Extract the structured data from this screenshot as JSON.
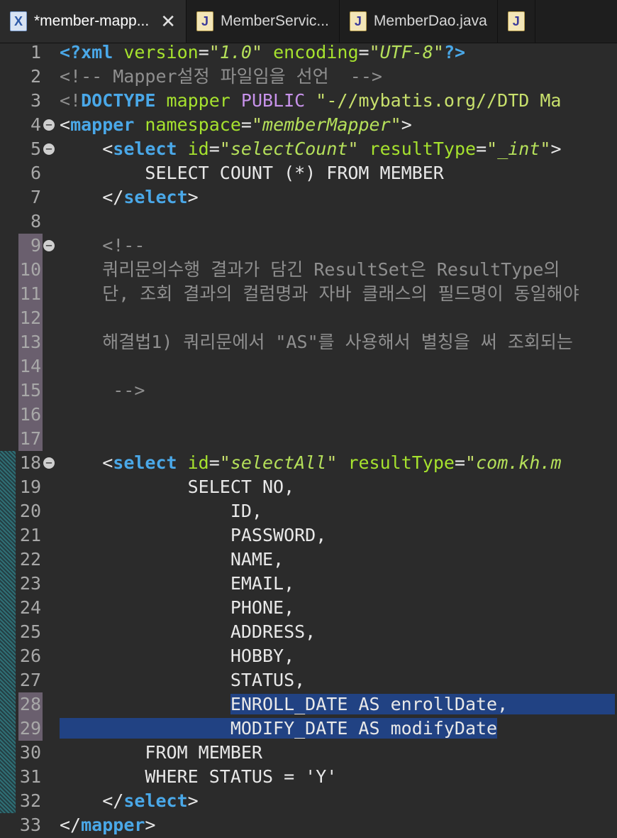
{
  "tabs": [
    {
      "label": "*member-mapp...",
      "icon": "xml-file-icon",
      "active": true
    },
    {
      "label": "MemberServic...",
      "icon": "java-file-icon",
      "active": false
    },
    {
      "label": "MemberDao.java",
      "icon": "java-file-icon",
      "active": false
    },
    {
      "label": "",
      "icon": "java-file-icon",
      "active": false
    }
  ],
  "icons": {
    "xml": "X",
    "java": "J"
  },
  "lines": [
    {
      "n": "1",
      "parts": [
        [
          "t-tag",
          "<?xml"
        ],
        [
          "t-attr",
          " version"
        ],
        [
          "t-eq",
          "="
        ],
        [
          "t-str",
          "\""
        ],
        [
          "t-strv",
          "1.0"
        ],
        [
          "t-str",
          "\""
        ],
        [
          "t-attr",
          " encoding"
        ],
        [
          "t-eq",
          "="
        ],
        [
          "t-str",
          "\""
        ],
        [
          "t-strv",
          "UTF-8"
        ],
        [
          "t-str",
          "\""
        ],
        [
          "t-tag",
          "?>"
        ]
      ]
    },
    {
      "n": "2",
      "parts": [
        [
          "t-comment",
          "<!-- Mapper설정 파일임을 선언  -->"
        ]
      ]
    },
    {
      "n": "3",
      "parts": [
        [
          "t-comment",
          "<!"
        ],
        [
          "t-tag",
          "DOCTYPE"
        ],
        [
          "t-bracket",
          " "
        ],
        [
          "t-attr",
          "mapper"
        ],
        [
          "t-bracket",
          " "
        ],
        [
          "t-doctype",
          "PUBLIC"
        ],
        [
          "t-bracket",
          " "
        ],
        [
          "t-str",
          "\"-//mybatis.org//DTD Ma"
        ]
      ]
    },
    {
      "n": "4",
      "fold": true,
      "parts": [
        [
          "t-bracket",
          "<"
        ],
        [
          "t-tag",
          "mapper"
        ],
        [
          "t-attr",
          " namespace"
        ],
        [
          "t-eq",
          "="
        ],
        [
          "t-str",
          "\""
        ],
        [
          "t-strv",
          "memberMapper"
        ],
        [
          "t-str",
          "\""
        ],
        [
          "t-bracket",
          ">"
        ]
      ]
    },
    {
      "n": "5",
      "fold": true,
      "parts": [
        [
          "t-bracket",
          "    <"
        ],
        [
          "t-tag",
          "select"
        ],
        [
          "t-attr",
          " id"
        ],
        [
          "t-eq",
          "="
        ],
        [
          "t-str",
          "\""
        ],
        [
          "t-strv",
          "selectCount"
        ],
        [
          "t-str",
          "\""
        ],
        [
          "t-attr",
          " resultType"
        ],
        [
          "t-eq",
          "="
        ],
        [
          "t-str",
          "\""
        ],
        [
          "t-strv",
          "_int"
        ],
        [
          "t-str",
          "\""
        ],
        [
          "t-bracket",
          ">"
        ]
      ]
    },
    {
      "n": "6",
      "parts": [
        [
          "t-bracket",
          "        SELECT COUNT (*) FROM MEMBER"
        ]
      ]
    },
    {
      "n": "7",
      "parts": [
        [
          "t-bracket",
          "    </"
        ],
        [
          "t-tag",
          "select"
        ],
        [
          "t-bracket",
          ">"
        ]
      ]
    },
    {
      "n": "8",
      "parts": []
    },
    {
      "n": "9",
      "fold": true,
      "purple": true,
      "parts": [
        [
          "t-comment",
          "    <!--"
        ]
      ]
    },
    {
      "n": "10",
      "purple": true,
      "parts": [
        [
          "t-comment",
          "    쿼리문의수행 결과가 담긴 ResultSet은 ResultType의 "
        ]
      ]
    },
    {
      "n": "11",
      "purple": true,
      "parts": [
        [
          "t-comment",
          "    단, 조회 결과의 컬럼명과 자바 클래스의 필드명이 동일해야"
        ]
      ]
    },
    {
      "n": "12",
      "purple": true,
      "parts": []
    },
    {
      "n": "13",
      "purple": true,
      "parts": [
        [
          "t-comment",
          "    해결법1) 쿼리문에서 \"AS\"를 사용해서 별칭을 써 조회되는 "
        ]
      ]
    },
    {
      "n": "14",
      "purple": true,
      "parts": []
    },
    {
      "n": "15",
      "purple": true,
      "parts": [
        [
          "t-comment",
          "     -->"
        ]
      ]
    },
    {
      "n": "16",
      "purple": true,
      "parts": []
    },
    {
      "n": "17",
      "purple": true,
      "parts": []
    },
    {
      "n": "18",
      "fold": true,
      "teal": true,
      "parts": [
        [
          "t-bracket",
          "    <"
        ],
        [
          "t-tag",
          "select"
        ],
        [
          "t-attr",
          " id"
        ],
        [
          "t-eq",
          "="
        ],
        [
          "t-str",
          "\""
        ],
        [
          "t-strv",
          "selectAll"
        ],
        [
          "t-str",
          "\""
        ],
        [
          "t-attr",
          " resultType"
        ],
        [
          "t-eq",
          "="
        ],
        [
          "t-str",
          "\""
        ],
        [
          "t-strv",
          "com.kh.m"
        ]
      ]
    },
    {
      "n": "19",
      "teal": true,
      "parts": [
        [
          "t-bracket",
          "            SELECT NO,"
        ]
      ]
    },
    {
      "n": "20",
      "teal": true,
      "parts": [
        [
          "t-bracket",
          "                ID,"
        ]
      ]
    },
    {
      "n": "21",
      "teal": true,
      "parts": [
        [
          "t-bracket",
          "                PASSWORD,"
        ]
      ]
    },
    {
      "n": "22",
      "teal": true,
      "parts": [
        [
          "t-bracket",
          "                NAME,"
        ]
      ]
    },
    {
      "n": "23",
      "teal": true,
      "parts": [
        [
          "t-bracket",
          "                EMAIL,"
        ]
      ]
    },
    {
      "n": "24",
      "teal": true,
      "parts": [
        [
          "t-bracket",
          "                PHONE,"
        ]
      ]
    },
    {
      "n": "25",
      "teal": true,
      "parts": [
        [
          "t-bracket",
          "                ADDRESS,"
        ]
      ]
    },
    {
      "n": "26",
      "teal": true,
      "parts": [
        [
          "t-bracket",
          "                HOBBY,"
        ]
      ]
    },
    {
      "n": "27",
      "teal": true,
      "parts": [
        [
          "t-bracket",
          "                STATUS,"
        ]
      ]
    },
    {
      "n": "28",
      "teal": true,
      "purple": true,
      "sel": "partial",
      "parts": [
        [
          "t-bracket",
          "                "
        ],
        [
          "sel",
          "ENROLL_DATE AS enrollDate,          "
        ]
      ]
    },
    {
      "n": "29",
      "teal": true,
      "purple": true,
      "sel": "full",
      "parts": [
        [
          "sel",
          "                MODIFY_DATE AS modifyDate"
        ]
      ]
    },
    {
      "n": "30",
      "teal": true,
      "parts": [
        [
          "t-bracket",
          "        FROM MEMBER"
        ]
      ]
    },
    {
      "n": "31",
      "teal": true,
      "parts": [
        [
          "t-bracket",
          "        WHERE STATUS = 'Y'"
        ]
      ]
    },
    {
      "n": "32",
      "teal": true,
      "parts": [
        [
          "t-bracket",
          "    </"
        ],
        [
          "t-tag",
          "select"
        ],
        [
          "t-bracket",
          ">"
        ]
      ]
    },
    {
      "n": "33",
      "parts": [
        [
          "t-bracket",
          "</"
        ],
        [
          "t-tag",
          "mapper"
        ],
        [
          "t-bracket",
          ">"
        ]
      ]
    }
  ]
}
